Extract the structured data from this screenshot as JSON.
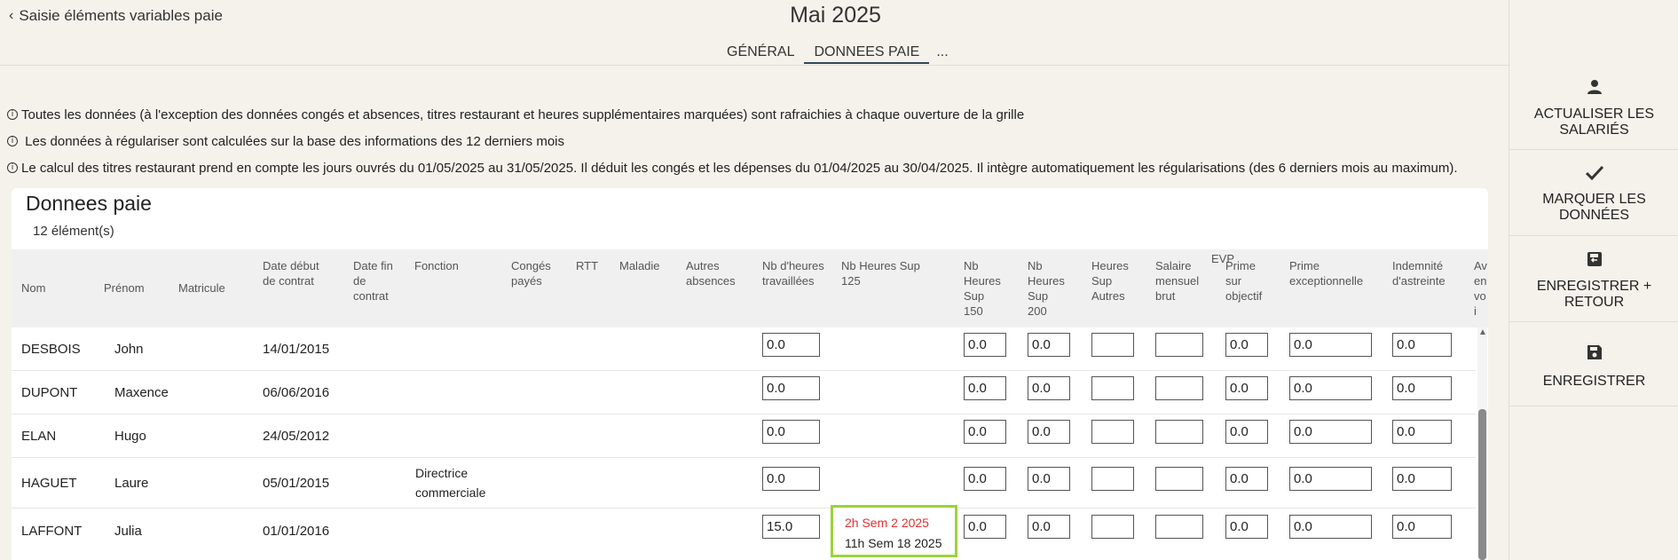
{
  "header": {
    "back_label": "Saisie éléments variables paie",
    "title": "Mai 2025",
    "tabs": [
      "GÉNÉRAL",
      "DONNEES PAIE",
      "..."
    ]
  },
  "infos": [
    "Toutes les données (à l'exception des données congés et absences, titres restaurant et heures supplémentaires marquées) sont rafraichies à chaque ouverture de la grille",
    " Les données à régulariser sont calculées sur la base des informations des 12 derniers mois",
    "Le calcul des titres restaurant prend en compte les jours ouvrés du 01/05/2025 au 31/05/2025. Il déduit les congés et les dépenses du 01/04/2025 au 30/04/2025. Il intègre automatiquement les régularisations (des 6 derniers mois au maximum)."
  ],
  "card": {
    "title": "Donnees paie",
    "count": "12 élément(s)",
    "group_label": "EVP",
    "columns": {
      "nom": "Nom",
      "prenom": "Prénom",
      "matricule": "Matricule",
      "date_debut": "Date début de contrat",
      "date_fin": "Date fin de contrat",
      "fonction": "Fonction",
      "conges": "Congés payés",
      "rtt": "RTT",
      "maladie": "Maladie",
      "autres_absences": "Autres absences",
      "nb_heures": "Nb d'heures travaillées",
      "hs125": "Nb Heures Sup 125",
      "hs150": "Nb Heures Sup 150",
      "hs200": "Nb Heures Sup 200",
      "hs_autres": "Heures Sup Autres",
      "salaire": "Salaire mensuel brut",
      "prime_obj": "Prime sur objectif",
      "prime_exc": "Prime exceptionnelle",
      "astreinte": "Indemnité d'astreinte",
      "avantage": "Av en voi"
    },
    "rows": [
      {
        "nom": "DESBOIS",
        "prenom": "John",
        "date_debut": "14/01/2015",
        "fonction": "",
        "nb_heures": "0.0",
        "hs150": "0.0",
        "hs200": "0.0",
        "hs_autres": "",
        "salaire": "",
        "prime_obj": "0.0",
        "prime_exc": "0.0",
        "astreinte": "0.0"
      },
      {
        "nom": "DUPONT",
        "prenom": "Maxence",
        "date_debut": "06/06/2016",
        "fonction": "",
        "nb_heures": "0.0",
        "hs150": "0.0",
        "hs200": "0.0",
        "hs_autres": "",
        "salaire": "",
        "prime_obj": "0.0",
        "prime_exc": "0.0",
        "astreinte": "0.0"
      },
      {
        "nom": "ELAN",
        "prenom": "Hugo",
        "date_debut": "24/05/2012",
        "fonction": "",
        "nb_heures": "0.0",
        "hs150": "0.0",
        "hs200": "0.0",
        "hs_autres": "",
        "salaire": "",
        "prime_obj": "0.0",
        "prime_exc": "0.0",
        "astreinte": "0.0"
      },
      {
        "nom": "HAGUET",
        "prenom": "Laure",
        "date_debut": "05/01/2015",
        "fonction": "Directrice commerciale",
        "nb_heures": "0.0",
        "hs150": "0.0",
        "hs200": "0.0",
        "hs_autres": "",
        "salaire": "",
        "prime_obj": "0.0",
        "prime_exc": "0.0",
        "astreinte": "0.0"
      },
      {
        "nom": "LAFFONT",
        "prenom": "Julia",
        "date_debut": "01/01/2016",
        "fonction": "",
        "nb_heures": "15.0",
        "hs150": "0.0",
        "hs200": "0.0",
        "hs_autres": "",
        "salaire": "",
        "prime_obj": "0.0",
        "prime_exc": "0.0",
        "astreinte": "0.0",
        "hs125_lines": [
          "2h Sem 2 2025",
          "11h Sem 18 2025"
        ]
      }
    ]
  },
  "sidepanel": {
    "buttons": [
      {
        "label": "ACTUALISER LES SALARIÉS",
        "icon": "person-icon"
      },
      {
        "label": "MARQUER LES DONNÉES",
        "icon": "check-icon"
      },
      {
        "label": "ENREGISTRER + RETOUR",
        "icon": "save-return-icon"
      },
      {
        "label": "ENREGISTRER",
        "icon": "save-icon"
      }
    ]
  },
  "colors": {
    "background": "#f5f2ec",
    "tab_underline": "#34475a",
    "highlight_border": "#9bd23b",
    "highlight_text": "#e0312e"
  }
}
